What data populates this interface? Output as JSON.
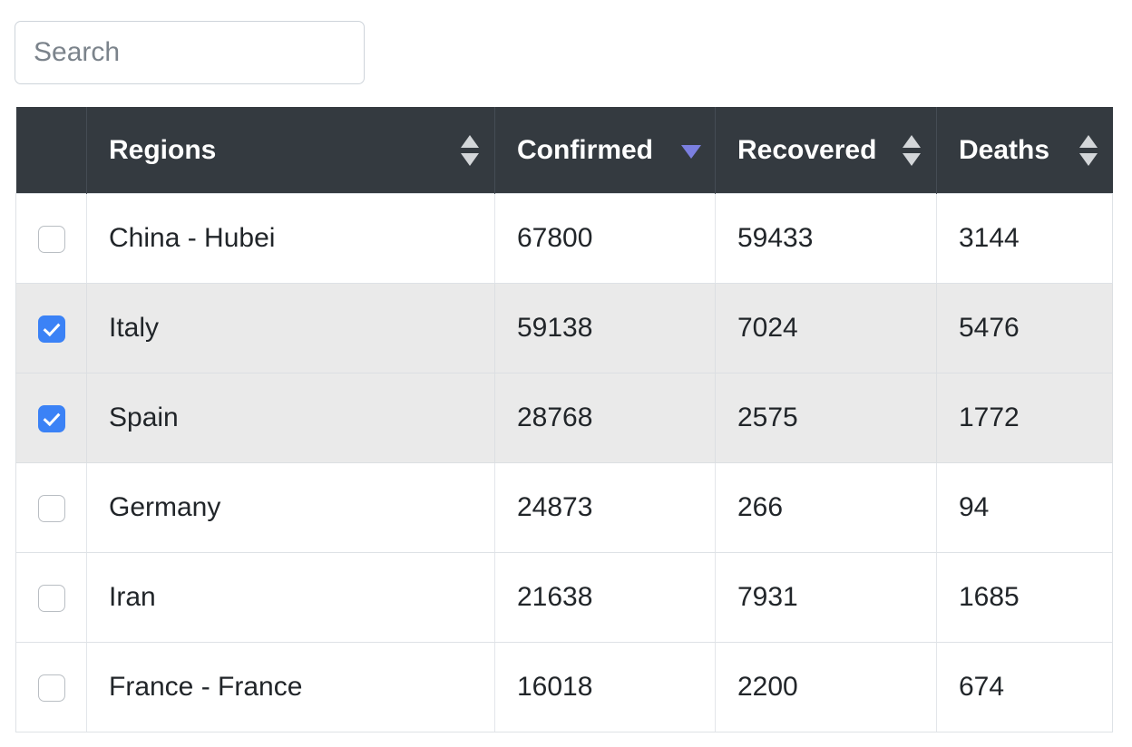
{
  "search": {
    "placeholder": "Search",
    "value": ""
  },
  "table": {
    "columns": [
      {
        "key": "select",
        "label": "",
        "sort": "none",
        "sort_icon": "sort-both-icon"
      },
      {
        "key": "regions",
        "label": "Regions",
        "sort": "none",
        "sort_icon": "sort-both-icon"
      },
      {
        "key": "confirmed",
        "label": "Confirmed",
        "sort": "desc",
        "sort_icon": "sort-desc-icon"
      },
      {
        "key": "recovered",
        "label": "Recovered",
        "sort": "none",
        "sort_icon": "sort-both-icon"
      },
      {
        "key": "deaths",
        "label": "Deaths",
        "sort": "none",
        "sort_icon": "sort-both-icon"
      }
    ],
    "rows": [
      {
        "selected": false,
        "region": "China - Hubei",
        "confirmed": "67800",
        "recovered": "59433",
        "deaths": "3144"
      },
      {
        "selected": true,
        "region": "Italy",
        "confirmed": "59138",
        "recovered": "7024",
        "deaths": "5476"
      },
      {
        "selected": true,
        "region": "Spain",
        "confirmed": "28768",
        "recovered": "2575",
        "deaths": "1772"
      },
      {
        "selected": false,
        "region": "Germany",
        "confirmed": "24873",
        "recovered": "266",
        "deaths": "94"
      },
      {
        "selected": false,
        "region": "Iran",
        "confirmed": "21638",
        "recovered": "7931",
        "deaths": "1685"
      },
      {
        "selected": false,
        "region": "France - France",
        "confirmed": "16018",
        "recovered": "2200",
        "deaths": "674"
      }
    ]
  },
  "colors": {
    "header_background": "#343A40",
    "header_text": "#FFFFFF",
    "active_sort_arrow": "#7B7FE0",
    "inactive_sort_arrow": "#D3D6D9",
    "checkbox_checked": "#3B82F6",
    "selected_row_background": "#EAEAEA",
    "row_background": "#FFFFFF",
    "border": "#DEE2E6",
    "placeholder_text": "#7B838B"
  }
}
